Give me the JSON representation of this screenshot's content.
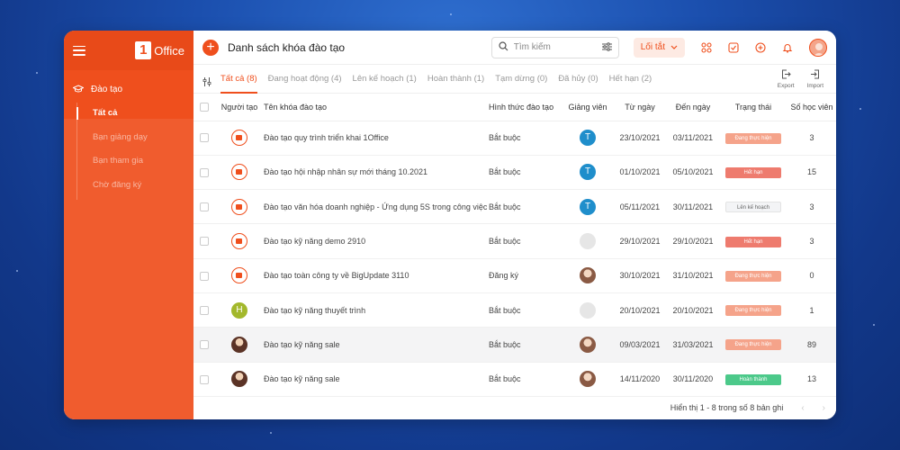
{
  "app": {
    "logo_text": "Office",
    "logo_mark": "1",
    "brand_color": "#ef4f1d"
  },
  "sidebar": {
    "section_label": "Đào tạo",
    "section_icon": "graduation-cap-icon",
    "items": [
      {
        "label": "Tất cả",
        "active": true
      },
      {
        "label": "Bạn giảng dạy",
        "active": false
      },
      {
        "label": "Bạn tham gia",
        "active": false
      },
      {
        "label": "Chờ đăng ký",
        "active": false
      }
    ]
  },
  "topbar": {
    "title": "Danh sách khóa đào tạo",
    "search_placeholder": "Tìm kiếm",
    "shortcut_label": "Lối tắt",
    "icons": [
      "grid-icon",
      "check-square-icon",
      "add-circle-icon",
      "bell-icon"
    ]
  },
  "tabs": [
    {
      "label": "Tất cả (8)",
      "active": true
    },
    {
      "label": "Đang hoạt động (4)",
      "active": false
    },
    {
      "label": "Lên kế hoạch (1)",
      "active": false
    },
    {
      "label": "Hoàn thành (1)",
      "active": false
    },
    {
      "label": "Tạm dừng (0)",
      "active": false
    },
    {
      "label": "Đã hủy (0)",
      "active": false
    },
    {
      "label": "Hết hạn (2)",
      "active": false
    }
  ],
  "toolbar": {
    "export_label": "Export",
    "import_label": "Import"
  },
  "table": {
    "headers": {
      "creator": "Người tạo",
      "name": "Tên khóa đào tạo",
      "type": "Hình thức đào tạo",
      "teacher": "Giảng viên",
      "from": "Từ ngày",
      "to": "Đến ngày",
      "status": "Trạng thái",
      "students": "Số học viên"
    },
    "rows": [
      {
        "creator_avatar": "logo",
        "name": "Đào tạo quy trình triển khai 1Office",
        "type": "Bắt buộc",
        "teacher": "T",
        "teacher_avatar": "letter-blue",
        "from": "23/10/2021",
        "to": "03/11/2021",
        "status": "Đang thực hiện",
        "status_color": "#f5a38a",
        "students": "3"
      },
      {
        "creator_avatar": "logo",
        "name": "Đào tạo hội nhập nhân sự mới tháng 10.2021",
        "type": "Bắt buộc",
        "teacher": "T",
        "teacher_avatar": "letter-blue",
        "from": "01/10/2021",
        "to": "05/10/2021",
        "status": "Hết hạn",
        "status_color": "#ee7b6e",
        "students": "15"
      },
      {
        "creator_avatar": "logo",
        "name": "Đào tạo văn hóa doanh nghiệp - Ứng dụng 5S trong công việc",
        "type": "Bắt buộc",
        "teacher": "T",
        "teacher_avatar": "letter-blue",
        "from": "05/11/2021",
        "to": "30/11/2021",
        "status": "Lên kế hoạch",
        "status_color": "#f3f4f6",
        "students": "3"
      },
      {
        "creator_avatar": "logo",
        "name": "Đào tạo kỹ năng demo 2910",
        "type": "Bắt buộc",
        "teacher": "",
        "teacher_avatar": "grey",
        "from": "29/10/2021",
        "to": "29/10/2021",
        "status": "Hết hạn",
        "status_color": "#ee7b6e",
        "students": "3"
      },
      {
        "creator_avatar": "logo",
        "name": "Đào tạo toàn công ty về BigUpdate 3110",
        "type": "Đăng ký",
        "teacher": "",
        "teacher_avatar": "photo2",
        "from": "30/10/2021",
        "to": "31/10/2021",
        "status": "Đang thực hiện",
        "status_color": "#f5a38a",
        "students": "0"
      },
      {
        "creator_avatar": "letter-green",
        "creator_letter": "H",
        "name": "Đào tạo kỹ năng thuyết trình",
        "type": "Bắt buộc",
        "teacher": "",
        "teacher_avatar": "grey",
        "from": "20/10/2021",
        "to": "20/10/2021",
        "status": "Đang thực hiện",
        "status_color": "#f5a38a",
        "students": "1"
      },
      {
        "creator_avatar": "photo",
        "name": "Đào tạo kỹ năng sale",
        "type": "Bắt buộc",
        "teacher": "",
        "teacher_avatar": "photo2",
        "from": "09/03/2021",
        "to": "31/03/2021",
        "status": "Đang thực hiện",
        "status_color": "#f5a38a",
        "students": "89",
        "highlight": true
      },
      {
        "creator_avatar": "photo",
        "name": "Đào tạo kỹ năng sale",
        "type": "Bắt buộc",
        "teacher": "",
        "teacher_avatar": "photo2",
        "from": "14/11/2020",
        "to": "30/11/2020",
        "status": "Hoàn thành",
        "status_color": "#4cc98a",
        "students": "13"
      }
    ]
  },
  "footer": {
    "summary": "Hiển thị 1 - 8 trong số 8 bản ghi"
  }
}
